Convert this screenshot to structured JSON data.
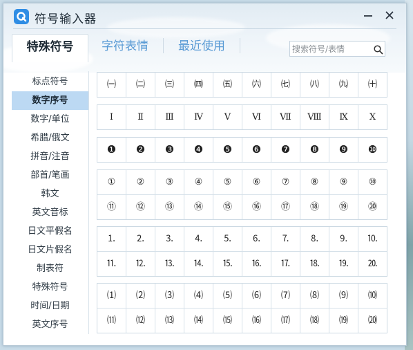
{
  "window": {
    "title": "符号输入器"
  },
  "tabs": [
    {
      "label": "特殊符号"
    },
    {
      "label": "字符表情"
    },
    {
      "label": "最近使用"
    }
  ],
  "search": {
    "placeholder": "搜索符号/表情"
  },
  "sidebar": {
    "items": [
      {
        "label": "标点符号"
      },
      {
        "label": "数字序号"
      },
      {
        "label": "数字/单位"
      },
      {
        "label": "希腊/俄文"
      },
      {
        "label": "拼音/注音"
      },
      {
        "label": "部首/笔画"
      },
      {
        "label": "韩文"
      },
      {
        "label": "英文音标"
      },
      {
        "label": "日文平假名"
      },
      {
        "label": "日文片假名"
      },
      {
        "label": "制表符"
      },
      {
        "label": "特殊符号"
      },
      {
        "label": "时间/日期"
      },
      {
        "label": "英文序号"
      }
    ],
    "active_index": 1
  },
  "symbol_groups": [
    {
      "rows": [
        [
          "㈠",
          "㈡",
          "㈢",
          "㈣",
          "㈤",
          "㈥",
          "㈦",
          "㈧",
          "㈨",
          "㈩"
        ]
      ]
    },
    {
      "rows": [
        [
          "Ⅰ",
          "Ⅱ",
          "Ⅲ",
          "Ⅳ",
          "Ⅴ",
          "Ⅵ",
          "Ⅶ",
          "Ⅷ",
          "Ⅸ",
          "Ⅹ"
        ]
      ]
    },
    {
      "rows": [
        [
          "❶",
          "❷",
          "❸",
          "❹",
          "❺",
          "❻",
          "❼",
          "❽",
          "❾",
          "❿"
        ]
      ]
    },
    {
      "rows": [
        [
          "①",
          "②",
          "③",
          "④",
          "⑤",
          "⑥",
          "⑦",
          "⑧",
          "⑨",
          "⑩"
        ],
        [
          "⑪",
          "⑫",
          "⑬",
          "⑭",
          "⑮",
          "⑯",
          "⑰",
          "⑱",
          "⑲",
          "⑳"
        ]
      ]
    },
    {
      "rows": [
        [
          "⒈",
          "⒉",
          "⒊",
          "⒋",
          "⒌",
          "⒍",
          "⒎",
          "⒏",
          "⒐",
          "⒑"
        ],
        [
          "⒒",
          "⒓",
          "⒔",
          "⒕",
          "⒖",
          "⒗",
          "⒘",
          "⒙",
          "⒚",
          "⒛"
        ]
      ]
    },
    {
      "rows": [
        [
          "⑴",
          "⑵",
          "⑶",
          "⑷",
          "⑸",
          "⑹",
          "⑺",
          "⑻",
          "⑼",
          "⑽"
        ],
        [
          "⑾",
          "⑿",
          "⒀",
          "⒁",
          "⒂",
          "⒃",
          "⒄",
          "⒅",
          "⒆",
          "⒇"
        ]
      ]
    }
  ],
  "colors": {
    "accent": "#2f8de4",
    "active_item_bg": "#bcd9f3",
    "inactive_tab": "#5a9bd5"
  },
  "icons": {
    "logo": "app-logo-icon",
    "minimize": "minimize-icon",
    "close": "close-icon",
    "search": "search-icon"
  }
}
